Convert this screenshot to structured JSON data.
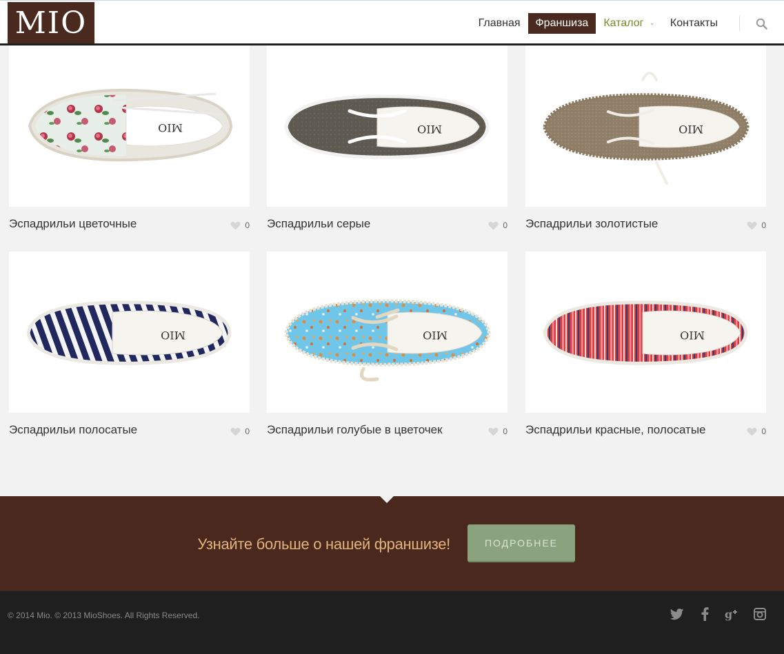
{
  "brand": {
    "logo_text": "MIO"
  },
  "nav": {
    "items": [
      {
        "label": "Главная"
      },
      {
        "label": "Франшиза"
      },
      {
        "label": "Каталог",
        "chevron": "⌄"
      },
      {
        "label": "Контакты"
      }
    ]
  },
  "products": [
    {
      "title": "Эспадрильи цветочные",
      "likes": "0"
    },
    {
      "title": "Эспадрильи серые",
      "likes": "0"
    },
    {
      "title": "Эспадрильи золотистые",
      "likes": "0"
    },
    {
      "title": "Эспадрильи полосатые",
      "likes": "0"
    },
    {
      "title": "Эспадрильи голубые в цветочек",
      "likes": "0"
    },
    {
      "title": "Эспадрильи красные, полосатые",
      "likes": "0"
    }
  ],
  "shoe_print": "MIO",
  "franchise": {
    "text": "Узнайте больше о нашей франшизе!",
    "button": "ПОДРОБНЕЕ"
  },
  "footer": {
    "copyright": "© 2014 Mio. © 2013 MioShoes. All Rights Reserved."
  },
  "icons": {
    "search": "search-icon",
    "like": "heart-icon",
    "socials": [
      "twitter-icon",
      "facebook-icon",
      "google-plus-icon",
      "instagram-icon"
    ]
  },
  "colors": {
    "brand_brown": "#4a2a1f",
    "accent_gold": "#e0b47b",
    "button_green": "#8aa37e",
    "catalog_olive": "#7a8a2a"
  }
}
